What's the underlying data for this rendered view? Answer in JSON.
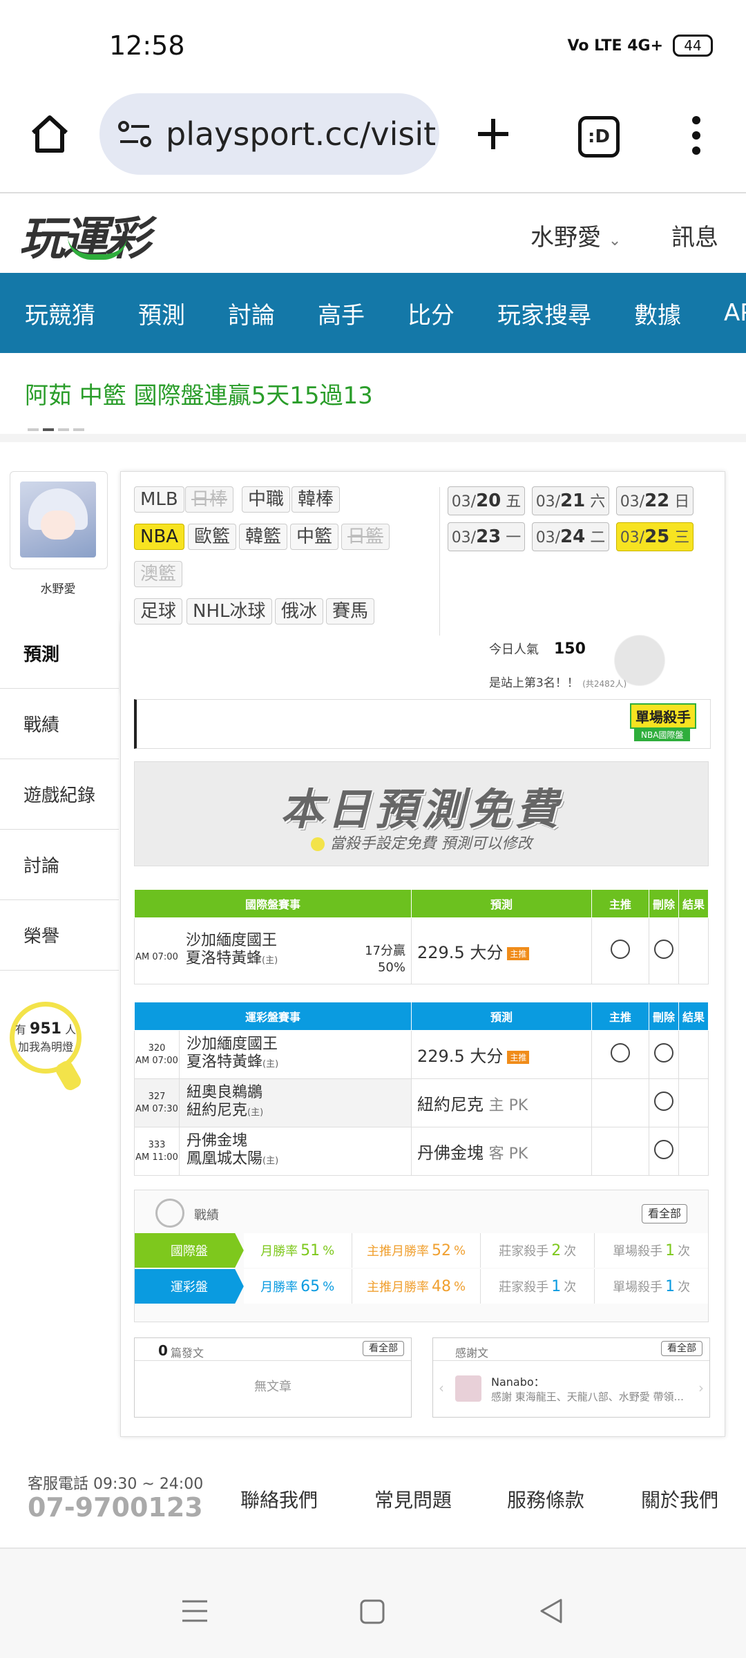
{
  "status": {
    "time": "12:58",
    "signal": "Vo LTE 4G+",
    "battery": "44"
  },
  "browser": {
    "url": "playsport.cc/visit",
    "tabs_label": ":D"
  },
  "site": {
    "logo": "玩運彩",
    "user": "水野愛",
    "message": "訊息"
  },
  "nav": [
    "玩競猜",
    "預測",
    "討論",
    "高手",
    "比分",
    "玩家搜尋",
    "數據",
    "APP"
  ],
  "ticker": "阿茹 中籃 國際盤連贏5天15過13",
  "profile": {
    "name": "水野愛"
  },
  "sidebar": [
    "預測",
    "戰績",
    "遊戲紀錄",
    "討論",
    "榮譽"
  ],
  "fans": {
    "prefix": "有",
    "count": "951",
    "unit": "人",
    "caption": "加我為明燈"
  },
  "leagues": {
    "row1": [
      "MLB",
      "日棒",
      "中職",
      "韓棒"
    ],
    "row2": [
      "NBA",
      "歐籃",
      "韓籃",
      "中籃",
      "日籃"
    ],
    "row3": [
      "澳籃"
    ],
    "row4": [
      "足球",
      "NHL冰球",
      "俄冰",
      "賽馬"
    ]
  },
  "dates": [
    {
      "md": "03/",
      "d": "20",
      "w": "五"
    },
    {
      "md": "03/",
      "d": "21",
      "w": "六"
    },
    {
      "md": "03/",
      "d": "22",
      "w": "日"
    },
    {
      "md": "03/",
      "d": "23",
      "w": "一"
    },
    {
      "md": "03/",
      "d": "24",
      "w": "二"
    },
    {
      "md": "03/",
      "d": "25",
      "w": "三"
    }
  ],
  "popularity": {
    "label": "今日人氣",
    "value": "150",
    "rank": "是站上第3名！！",
    "total": "(共2482人)"
  },
  "killer_badge": {
    "title": "單場殺手",
    "sub": "NBA國際盤"
  },
  "banner": {
    "title": "本日預測免費",
    "subtitle": "當殺手設定免費  預測可以修改"
  },
  "intl_table": {
    "headers": [
      "國際盤賽事",
      "預測",
      "主推",
      "刪除",
      "結果"
    ],
    "rows": [
      {
        "num": "",
        "time": "AM 07:00",
        "away": "沙加緬度國王",
        "home": "夏洛特黃蜂",
        "home_tag": "(主)",
        "result": "17分贏",
        "result_pct": "50%",
        "pred": "229.5 大分",
        "tag": "主推"
      }
    ]
  },
  "sports_table": {
    "headers": [
      "運彩盤賽事",
      "預測",
      "主推",
      "刪除",
      "結果"
    ],
    "rows": [
      {
        "num": "320",
        "time": "AM 07:00",
        "away": "沙加緬度國王",
        "home": "夏洛特黃蜂",
        "home_tag": "(主)",
        "pred": "229.5 大分",
        "pred_note": "",
        "tag": "主推"
      },
      {
        "num": "327",
        "time": "AM 07:30",
        "away": "紐奧良鵜鶘",
        "home": "紐約尼克",
        "home_tag": "(主)",
        "pred": "紐約尼克",
        "pred_note": "主 PK",
        "tag": ""
      },
      {
        "num": "333",
        "time": "AM 11:00",
        "away": "丹佛金塊",
        "home": "鳳凰城太陽",
        "home_tag": "(主)",
        "pred": "丹佛金塊",
        "pred_note": "客 PK",
        "tag": ""
      }
    ]
  },
  "record": {
    "title": "戰績",
    "view_all": "看全部",
    "rows": [
      {
        "label": "國際盤",
        "win_label": "月勝率",
        "win": "51",
        "main_label": "主推月勝率",
        "main": "52",
        "house_label": "莊家殺手",
        "house": "2",
        "single_label": "單場殺手",
        "single": "1",
        "pct": "%",
        "times": "次",
        "color": "#7ec81d"
      },
      {
        "label": "運彩盤",
        "win_label": "月勝率",
        "win": "65",
        "main_label": "主推月勝率",
        "main": "48",
        "house_label": "莊家殺手",
        "house": "1",
        "single_label": "單場殺手",
        "single": "1",
        "pct": "%",
        "times": "次",
        "color": "#0a9be0"
      }
    ]
  },
  "articles": {
    "count": "0",
    "label": "篇發文",
    "view_all": "看全部",
    "empty": "無文章"
  },
  "thanks": {
    "title": "感謝文",
    "view_all": "看全部",
    "author": "Nanabo：",
    "text": "感謝 東海龍王、天龍八部、水野愛 帶領..."
  },
  "footer": {
    "hours": "客服電話 09:30 ~ 24:00",
    "phone": "07-9700123",
    "links": [
      "聯絡我們",
      "常見問題",
      "服務條款",
      "關於我們"
    ]
  }
}
